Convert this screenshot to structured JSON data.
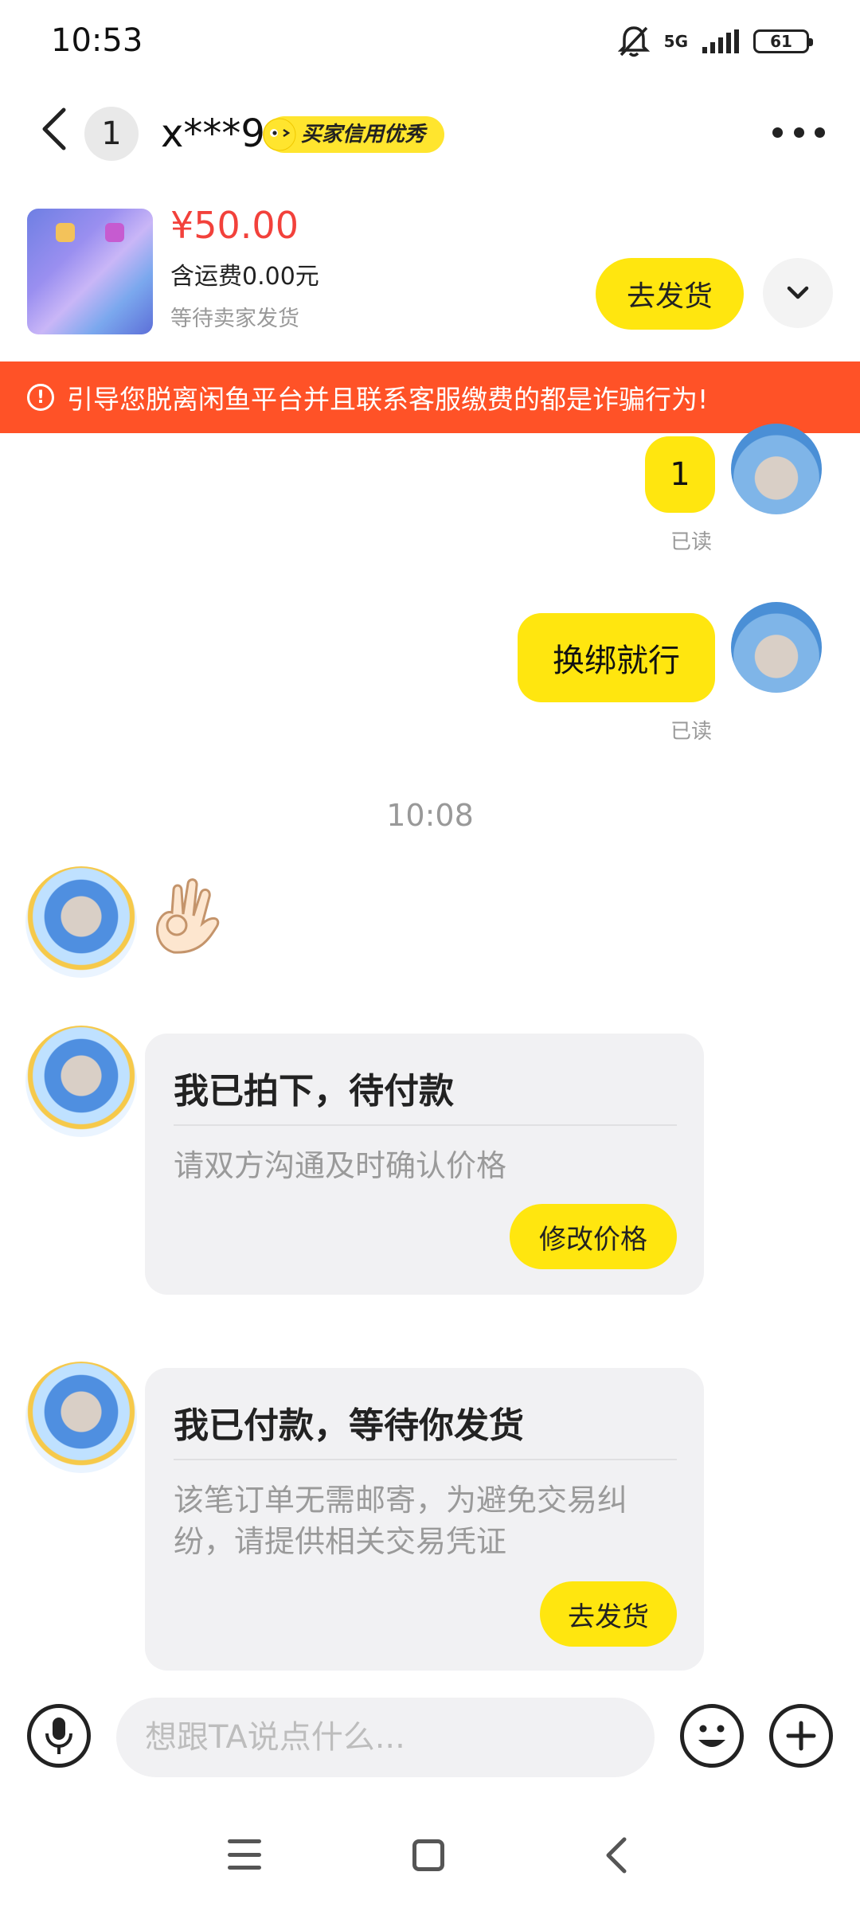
{
  "status_bar": {
    "time": "10:53",
    "network": "5G",
    "battery": "61"
  },
  "header": {
    "unread_count": "1",
    "peer_name": "x***9",
    "credit_badge": "买家信用优秀"
  },
  "order": {
    "price": "¥50.00",
    "shipping": "含运费0.00元",
    "status": "等待卖家发货",
    "ship_button": "去发货"
  },
  "warning": {
    "text": "引导您脱离闲鱼平台并且联系客服缴费的都是诈骗行为!"
  },
  "messages": {
    "m1": {
      "text": "1",
      "read": "已读"
    },
    "m2": {
      "text": "换绑就行",
      "read": "已读"
    },
    "time_separator": "10:08",
    "card1": {
      "title": "我已拍下，待付款",
      "desc": "请双方沟通及时确认价格",
      "button": "修改价格"
    },
    "card2": {
      "title": "我已付款，等待你发货",
      "desc": "该笔订单无需邮寄，为避免交易纠纷，请提供相关交易凭证",
      "button": "去发货"
    }
  },
  "input": {
    "placeholder": "想跟TA说点什么..."
  },
  "icons": {
    "back": "chevron-left-icon",
    "more": "more-dots-icon",
    "expand": "chevron-down-icon",
    "warning": "exclamation-circle-icon",
    "mic": "microphone-icon",
    "emoji": "smiley-icon",
    "plus": "plus-circle-icon"
  },
  "colors": {
    "accent_yellow": "#ffe60f",
    "price_red": "#f2413b",
    "warning_orange": "#ff5227"
  }
}
